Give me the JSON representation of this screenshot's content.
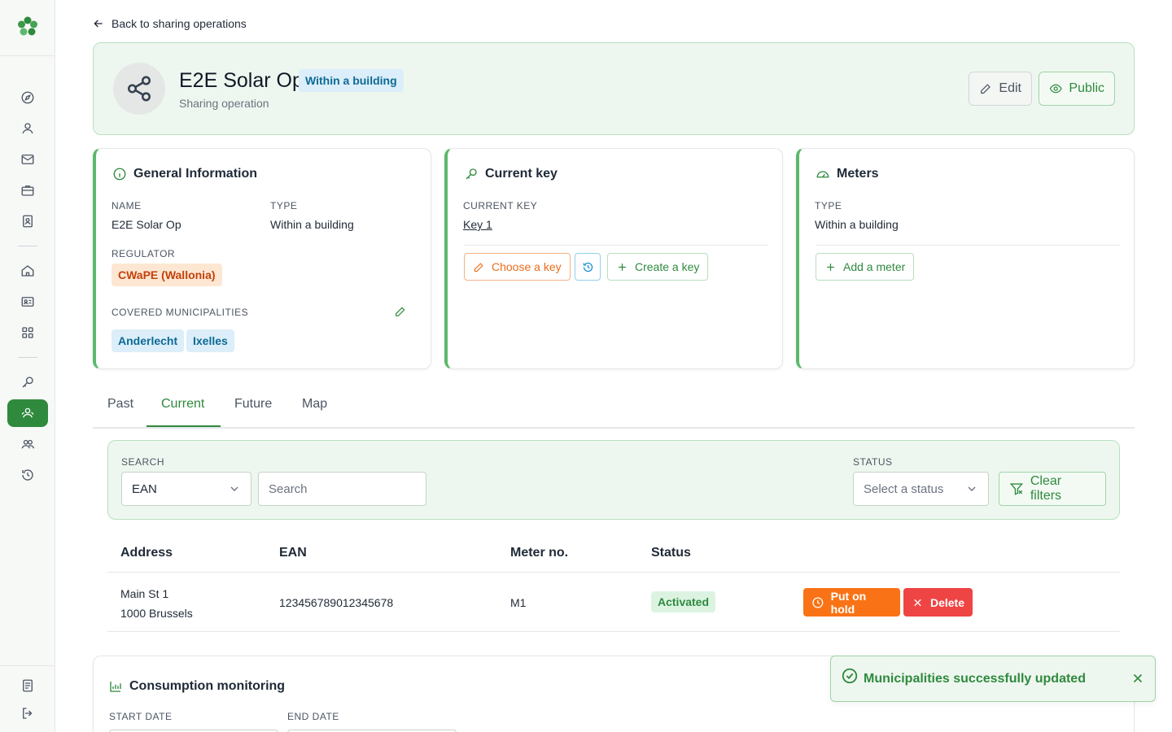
{
  "nav": {
    "back_label": "Back to sharing operations"
  },
  "header": {
    "title": "E2E Solar Op",
    "badge": "Within a building",
    "subtitle": "Sharing operation",
    "edit_label": "Edit",
    "public_label": "Public"
  },
  "general_info": {
    "heading": "General Information",
    "name_label": "NAME",
    "name_value": "E2E Solar Op",
    "type_label": "TYPE",
    "type_value": "Within a building",
    "regulator_label": "REGULATOR",
    "regulator_value": "CWaPE (Wallonia)",
    "municipalities_label": "COVERED MUNICIPALITIES",
    "municipalities": [
      "Anderlecht",
      "Ixelles"
    ]
  },
  "current_key": {
    "heading": "Current key",
    "label": "CURRENT KEY",
    "value": "Key 1",
    "choose_label": "Choose a key",
    "create_label": "Create a key"
  },
  "meters": {
    "heading": "Meters",
    "type_label": "TYPE",
    "type_value": "Within a building",
    "add_label": "Add a meter"
  },
  "tabs": [
    "Past",
    "Current",
    "Future",
    "Map"
  ],
  "active_tab": "Current",
  "filters": {
    "search_label": "SEARCH",
    "search_field": "EAN",
    "search_placeholder": "Search",
    "status_label": "STATUS",
    "status_placeholder": "Select a status",
    "clear_label": "Clear filters"
  },
  "table": {
    "headers": [
      "Address",
      "EAN",
      "Meter no.",
      "Status"
    ],
    "rows": [
      {
        "address_line1": "Main St 1",
        "address_line2": "1000 Brussels",
        "ean": "123456789012345678",
        "meter_no": "M1",
        "status": "Activated",
        "hold_label": "Put on hold",
        "delete_label": "Delete"
      }
    ]
  },
  "consumption": {
    "heading": "Consumption monitoring",
    "start_label": "START DATE",
    "end_label": "END DATE"
  },
  "toast": {
    "message": "Municipalities successfully updated"
  },
  "colors": {
    "primary": "#2f8a3e",
    "accent_orange": "#f97316",
    "danger": "#ef4444",
    "info_badge_bg": "#dbeef9",
    "regulator_badge_bg": "#fde7d2"
  },
  "icons": {
    "sidebar": [
      "compass-icon",
      "user-icon",
      "mail-icon",
      "briefcase-icon",
      "contact-card-icon",
      "home-icon",
      "id-card-icon",
      "grid-icon",
      "key-icon",
      "users-icon",
      "group-icon",
      "history-icon",
      "document-icon",
      "logout-icon"
    ]
  }
}
